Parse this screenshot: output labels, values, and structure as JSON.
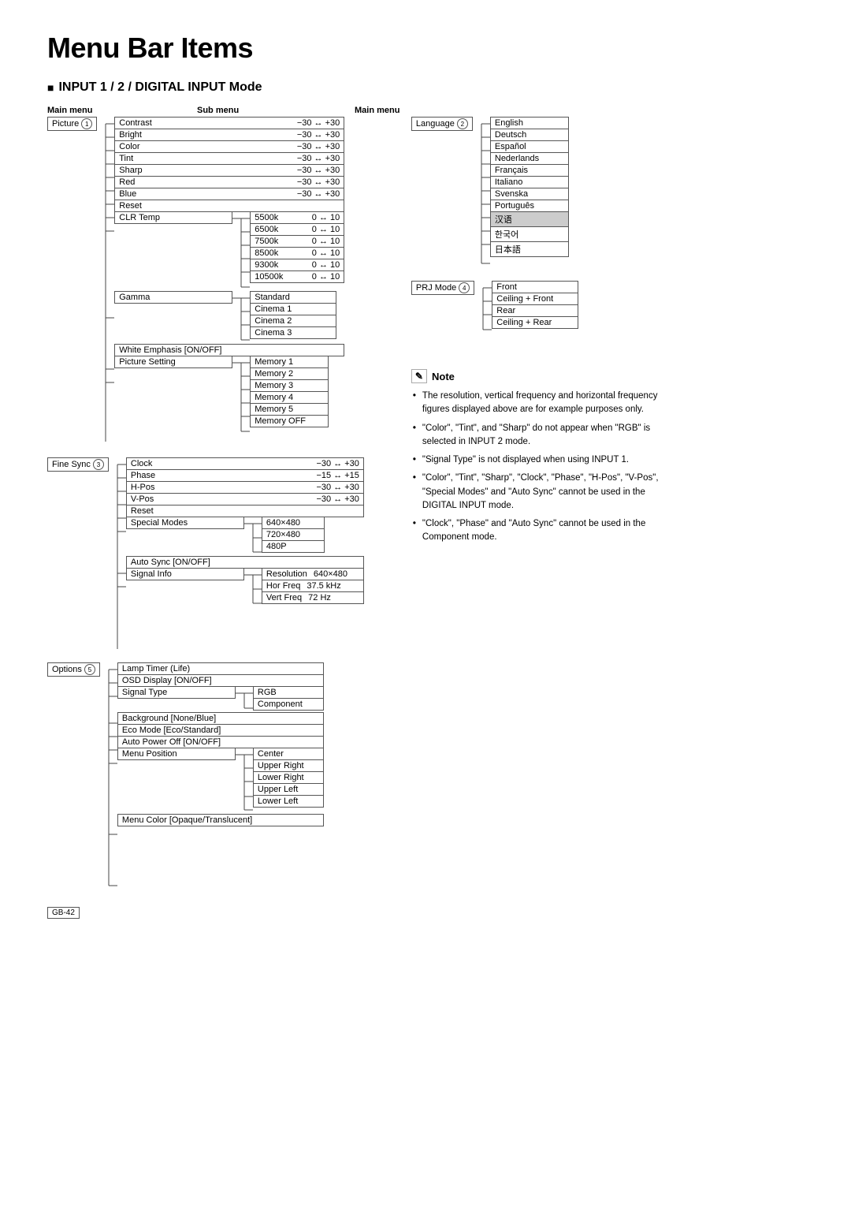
{
  "page": {
    "title": "Menu Bar Items",
    "section": "INPUT 1 / 2 / DIGITAL INPUT Mode"
  },
  "headers": {
    "main_menu": "Main menu",
    "sub_menu": "Sub menu"
  },
  "left_tree": {
    "picture_item": "Picture",
    "picture_icon": "1",
    "picture_sub": [
      {
        "label": "Contrast",
        "range": "−30 ↔ +30"
      },
      {
        "label": "Bright",
        "range": "−30 ↔ +30"
      },
      {
        "label": "Color",
        "range": "−30 ↔ +30"
      },
      {
        "label": "Tint",
        "range": "−30 ↔ +30"
      },
      {
        "label": "Sharp",
        "range": "−30 ↔ +30"
      },
      {
        "label": "Red",
        "range": "−30 ↔ +30"
      },
      {
        "label": "Blue",
        "range": "−30 ↔ +30"
      },
      {
        "label": "Reset",
        "range": ""
      },
      {
        "label": "CLR Temp",
        "range": ""
      },
      {
        "label": "Gamma",
        "range": ""
      },
      {
        "label": "White Emphasis  [ON/OFF]",
        "range": ""
      },
      {
        "label": "Picture Setting",
        "range": ""
      }
    ],
    "clr_temp_sub": [
      {
        "label": "5500k",
        "range": "0 ↔ 10"
      },
      {
        "label": "6500k",
        "range": "0 ↔ 10"
      },
      {
        "label": "7500k",
        "range": "0 ↔ 10"
      },
      {
        "label": "8500k",
        "range": "0 ↔ 10"
      },
      {
        "label": "9300k",
        "range": "0 ↔ 10"
      },
      {
        "label": "10500k",
        "range": "0 ↔ 10"
      }
    ],
    "gamma_sub": [
      "Standard",
      "Cinema 1",
      "Cinema 2",
      "Cinema 3"
    ],
    "picture_setting_sub": [
      "Memory 1",
      "Memory 2",
      "Memory 3",
      "Memory 4",
      "Memory 5",
      "Memory OFF"
    ],
    "fine_sync_item": "Fine Sync",
    "fine_sync_icon": "3",
    "fine_sync_sub": [
      {
        "label": "Clock",
        "range": "−30 ↔ +30"
      },
      {
        "label": "Phase",
        "range": "−15 ↔ +15"
      },
      {
        "label": "H-Pos",
        "range": "−30 ↔ +30"
      },
      {
        "label": "V-Pos",
        "range": "−30 ↔ +30"
      },
      {
        "label": "Reset",
        "range": ""
      },
      {
        "label": "Special Modes",
        "range": ""
      },
      {
        "label": "Auto Sync   [ON/OFF]",
        "range": ""
      },
      {
        "label": "Signal Info",
        "range": ""
      }
    ],
    "special_modes_sub": [
      "640×480",
      "720×480",
      "480P"
    ],
    "signal_info_sub": [
      {
        "label": "Resolution",
        "value": "640×480"
      },
      {
        "label": "Hor Freq",
        "value": "37.5 kHz"
      },
      {
        "label": "Vert Freq",
        "value": "72 Hz"
      }
    ],
    "options_item": "Options",
    "options_icon": "5",
    "options_sub": [
      {
        "label": "Lamp Timer (Life)",
        "range": ""
      },
      {
        "label": "OSD Display  [ON/OFF]",
        "range": ""
      },
      {
        "label": "Signal Type",
        "range": ""
      },
      {
        "label": "Background [None/Blue]",
        "range": ""
      },
      {
        "label": "Eco Mode [Eco/Standard]",
        "range": ""
      },
      {
        "label": "Auto Power Off [ON/OFF]",
        "range": ""
      },
      {
        "label": "Menu Position",
        "range": ""
      },
      {
        "label": "Menu Color [Opaque/Translucent]",
        "range": ""
      }
    ],
    "signal_type_sub": [
      "RGB",
      "Component"
    ],
    "menu_position_sub": [
      "Center",
      "Upper Right",
      "Lower Right",
      "Upper Left",
      "Lower Left"
    ]
  },
  "right_tree": {
    "language_item": "Language",
    "language_icon": "2",
    "language_sub": [
      "English",
      "Deutsch",
      "Español",
      "Nederlands",
      "Français",
      "Italiano",
      "Svenska",
      "Português",
      "汉语",
      "한국어",
      "日本語"
    ],
    "prj_mode_item": "PRJ Mode",
    "prj_mode_icon": "4",
    "prj_mode_sub": [
      "Front",
      "Ceiling + Front",
      "Rear",
      "Ceiling + Rear"
    ]
  },
  "notes": {
    "title": "Note",
    "items": [
      "The resolution, vertical frequency and horizontal frequency figures displayed above are for example purposes only.",
      "\"Color\", \"Tint\", and \"Sharp\" do not appear when \"RGB\" is selected in INPUT 2 mode.",
      "\"Signal Type\" is not displayed when using INPUT 1.",
      "\"Color\", \"Tint\", \"Sharp\", \"Clock\", \"Phase\", \"H-Pos\", \"V-Pos\", \"Special Modes\" and \"Auto Sync\" cannot be used in the DIGITAL INPUT mode.",
      "\"Clock\", \"Phase\" and \"Auto Sync\" cannot be used in the Component mode."
    ]
  },
  "page_number": {
    "label": "GB",
    "number": "-42"
  }
}
